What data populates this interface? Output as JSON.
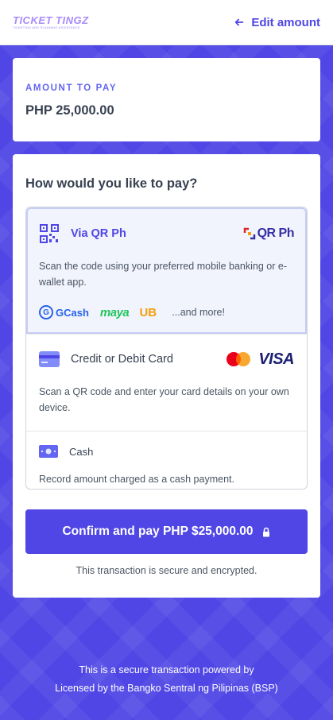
{
  "header": {
    "brand_name": "TICKET TINGZ",
    "brand_tagline": "TICKETING AND PLANNING ASSISTANCE",
    "edit_label": "Edit amount"
  },
  "amount": {
    "label": "AMOUNT TO PAY",
    "value": "PHP 25,000.00"
  },
  "payment": {
    "title": "How would you like to pay?",
    "qr": {
      "name": "Via QR Ph",
      "logo_text": "QR Ph",
      "description": "Scan the code using your preferred mobile banking or e-wallet app.",
      "wallets": [
        "GCash",
        "maya",
        "UB"
      ],
      "more_label": "...and more!"
    },
    "card": {
      "name": "Credit or Debit Card",
      "brand_visa": "VISA",
      "description": "Scan a QR code and enter your card details on your own device."
    },
    "cash": {
      "name": "Cash",
      "description": "Record amount charged as a cash payment."
    },
    "confirm_label": "Confirm and pay PHP $25,000.00",
    "secure_note": "This transaction is secure and encrypted."
  },
  "footer": {
    "line1": "This is a secure transaction powered by",
    "line2": "Licensed by the Bangko Sentral ng Pilipinas (BSP)"
  },
  "colors": {
    "accent": "#4f46e5",
    "qr_selected_bg": "#f1f3fd",
    "background": "#4f46e5"
  }
}
